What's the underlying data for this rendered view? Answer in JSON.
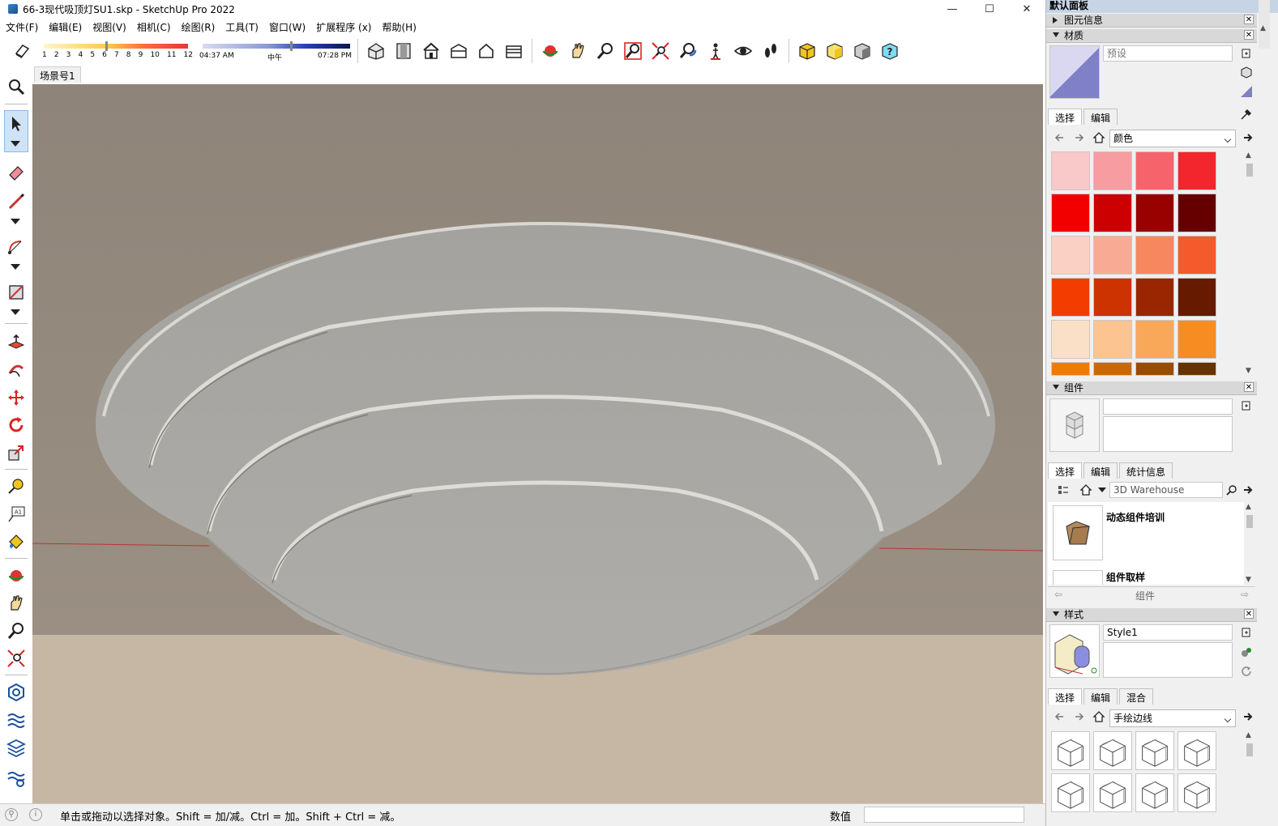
{
  "window": {
    "title": "66-3现代吸顶灯SU1.skp - SketchUp Pro 2022",
    "min": "—",
    "max": "☐",
    "close": "✕"
  },
  "menu": [
    "文件(F)",
    "编辑(E)",
    "视图(V)",
    "相机(C)",
    "绘图(R)",
    "工具(T)",
    "窗口(W)",
    "扩展程序 (x)",
    "帮助(H)"
  ],
  "shadow": {
    "months": [
      "1",
      "2",
      "3",
      "4",
      "5",
      "6",
      "7",
      "8",
      "9",
      "10",
      "11",
      "12"
    ],
    "time_start": "04:37 AM",
    "time_mid": "中午",
    "time_end": "07:28 PM"
  },
  "toolbar_icons": [
    "eraser-icon",
    "shadow-settings-icon",
    "iso-view-icon",
    "top-view-icon",
    "front-view-icon",
    "right-view-icon",
    "back-view-icon",
    "left-view-icon",
    "orbit-icon",
    "pan-icon",
    "zoom-icon",
    "zoom-window-icon",
    "zoom-extents-icon",
    "previous-view-icon",
    "position-camera-icon",
    "look-around-icon",
    "walk-icon",
    "warehouse-icon",
    "extension-warehouse-icon",
    "layout-icon",
    "help-icon"
  ],
  "scene": {
    "tab": "场景号1"
  },
  "dock": {
    "title": "默认面板",
    "entity_info": "图元信息",
    "materials": {
      "header": "材质",
      "name_placeholder": "预设",
      "tab_select": "选择",
      "tab_edit": "编辑",
      "library": "颜色",
      "swatches": [
        "#f9c8c8",
        "#f79ca0",
        "#f7636a",
        "#f2262c",
        "#f20000",
        "#cc0000",
        "#990000",
        "#660000",
        "#fbd0c4",
        "#f9aa94",
        "#f7875f",
        "#f45a2c",
        "#f23c00",
        "#cc3300",
        "#992600",
        "#661a00",
        "#fbe0c8",
        "#fbc491",
        "#f9a85a",
        "#f78c22",
        "#f27a00",
        "#cc6600",
        "#994c00",
        "#663300"
      ]
    },
    "components": {
      "header": "组件",
      "tab_select": "选择",
      "tab_edit": "编辑",
      "tab_stats": "统计信息",
      "search_placeholder": "3D Warehouse",
      "items": [
        "动态组件培训",
        "组件取样"
      ],
      "footer": "组件"
    },
    "styles": {
      "header": "样式",
      "name": "Style1",
      "tab_select": "选择",
      "tab_edit": "编辑",
      "tab_mix": "混合",
      "library": "手绘边线"
    }
  },
  "status": {
    "hint": "单击或拖动以选择对象。Shift = 加/减。Ctrl = 加。Shift + Ctrl = 减。",
    "vcb_label": "数值",
    "vcb_value": ""
  },
  "colors": {
    "wall": "#8e8578",
    "floor": "#c6b7a5",
    "lamp": "#a9a8a4",
    "accent": "#3a86c8"
  }
}
